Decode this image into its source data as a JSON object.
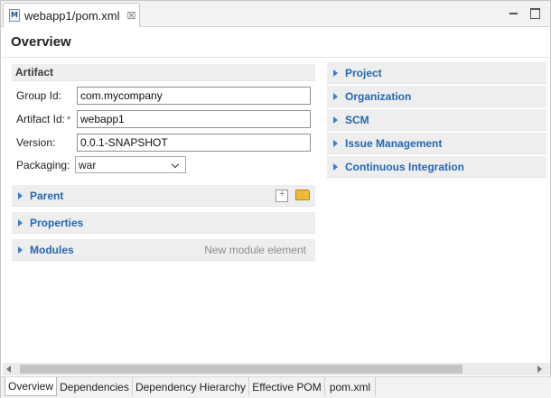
{
  "editor": {
    "tab_title": "webapp1/pom.xml",
    "tab_icon_letter": "M",
    "close_glyph": "☒"
  },
  "form": {
    "title": "Overview"
  },
  "artifact": {
    "header": "Artifact",
    "group_id_label": "Group Id:",
    "group_id_value": "com.mycompany",
    "artifact_id_label": "Artifact Id:",
    "artifact_id_required": "*",
    "artifact_id_value": "webapp1",
    "version_label": "Version:",
    "version_value": "0.0.1-SNAPSHOT",
    "packaging_label": "Packaging:",
    "packaging_value": "war"
  },
  "left_sections": {
    "parent": "Parent",
    "properties": "Properties",
    "modules": "Modules",
    "modules_hint": "New module element"
  },
  "right_sections": {
    "project": "Project",
    "organization": "Organization",
    "scm": "SCM",
    "issue_management": "Issue Management",
    "continuous_integration": "Continuous Integration"
  },
  "page_tabs": [
    "Overview",
    "Dependencies",
    "Dependency Hierarchy",
    "Effective POM",
    "pom.xml"
  ],
  "active_page_tab": "Overview",
  "colors": {
    "section_link": "#2467b3",
    "twisty": "#3b7ec9",
    "section_bg": "#eeeeee"
  }
}
